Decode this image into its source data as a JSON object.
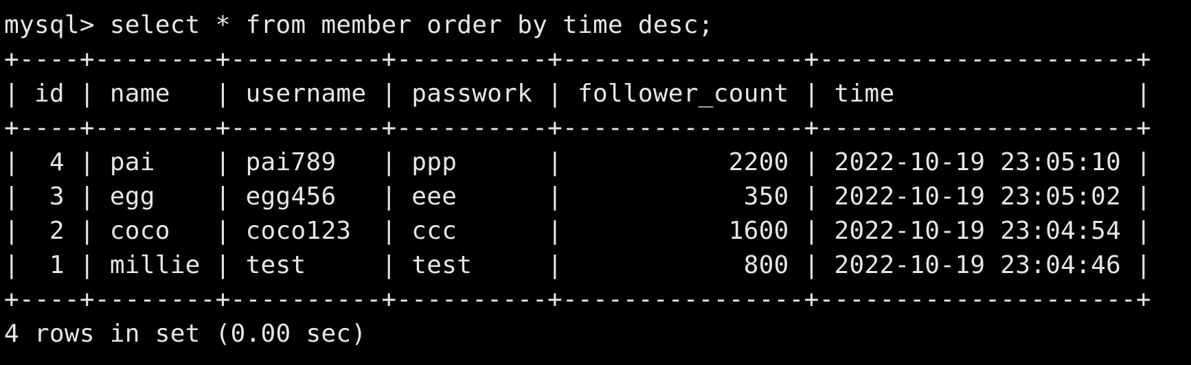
{
  "terminal": {
    "background": "#000000",
    "foreground": "#e6e6e6",
    "prompt_line": "mysql> select * from member order by time desc;",
    "border": "+----+--------+----------+----------+----------------+---------------------+",
    "header_row": "| id | name   | username | passwork | follower_count | time                |",
    "columns": [
      "id",
      "name",
      "username",
      "passwork",
      "follower_count",
      "time"
    ],
    "rows": [
      "|  4 | pai    | pai789   | ppp      |           2200 | 2022-10-19 23:05:10 |",
      "|  3 | egg    | egg456   | eee      |            350 | 2022-10-19 23:05:02 |",
      "|  2 | coco   | coco123  | ccc      |           1600 | 2022-10-19 23:04:54 |",
      "|  1 | millie | test     | test     |            800 | 2022-10-19 23:04:46 |"
    ],
    "records": [
      {
        "id": "4",
        "name": "pai",
        "username": "pai789",
        "passwork": "ppp",
        "follower_count": "2200",
        "time": "2022-10-19 23:05:10"
      },
      {
        "id": "3",
        "name": "egg",
        "username": "egg456",
        "passwork": "eee",
        "follower_count": "350",
        "time": "2022-10-19 23:05:02"
      },
      {
        "id": "2",
        "name": "coco",
        "username": "coco123",
        "passwork": "ccc",
        "follower_count": "1600",
        "time": "2022-10-19 23:04:54"
      },
      {
        "id": "1",
        "name": "millie",
        "username": "test",
        "passwork": "test",
        "follower_count": "800",
        "time": "2022-10-19 23:04:46"
      }
    ],
    "status_line": "4 rows in set (0.00 sec)"
  }
}
